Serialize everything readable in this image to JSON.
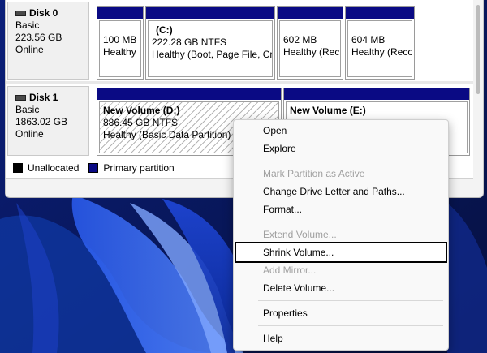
{
  "disks": [
    {
      "name": "Disk 0",
      "type": "Basic",
      "size": "223.56 GB",
      "status": "Online",
      "partitions": [
        {
          "title": "",
          "line1": "100 MB",
          "line2": "Healthy"
        },
        {
          "title": "(C:)",
          "line1": "222.28 GB NTFS",
          "line2": "Healthy (Boot, Page File, Cra"
        },
        {
          "title": "",
          "line1": "602 MB",
          "line2": "Healthy (Rec"
        },
        {
          "title": "",
          "line1": "604 MB",
          "line2": "Healthy (Reco"
        }
      ]
    },
    {
      "name": "Disk 1",
      "type": "Basic",
      "size": "1863.02 GB",
      "status": "Online",
      "partitions": [
        {
          "title": "New Volume  (D:)",
          "line1": "886.45 GB NTFS",
          "line2": "Healthy (Basic Data Partition)"
        },
        {
          "title": "New Volume  (E:)",
          "line1": "",
          "line2": ""
        }
      ]
    }
  ],
  "legend": {
    "unallocated": "Unallocated",
    "primary": "Primary partition",
    "unallocated_color": "#000000",
    "primary_color": "#0a0a84"
  },
  "context_menu": {
    "items": [
      {
        "label": "Open",
        "enabled": true
      },
      {
        "label": "Explore",
        "enabled": true
      },
      {
        "label": "Mark Partition as Active",
        "enabled": false
      },
      {
        "label": "Change Drive Letter and Paths...",
        "enabled": true
      },
      {
        "label": "Format...",
        "enabled": true
      },
      {
        "label": "Extend Volume...",
        "enabled": false
      },
      {
        "label": "Shrink Volume...",
        "enabled": true,
        "highlighted": true
      },
      {
        "label": "Add Mirror...",
        "enabled": false
      },
      {
        "label": "Delete Volume...",
        "enabled": true
      },
      {
        "label": "Properties",
        "enabled": true
      },
      {
        "label": "Help",
        "enabled": true
      }
    ]
  },
  "colors": {
    "partition_bar": "#0a0a84",
    "wallpaper": "#0a1a5e"
  }
}
